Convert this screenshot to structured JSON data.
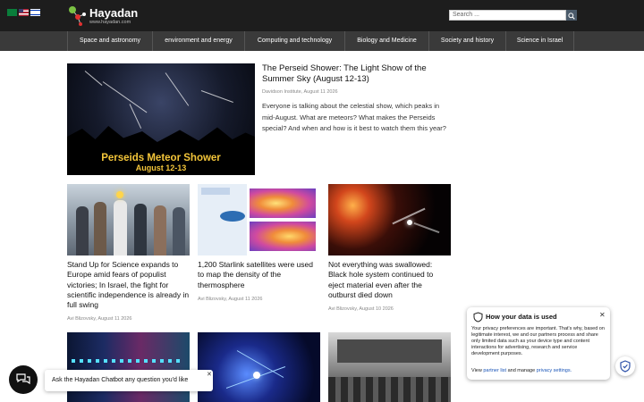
{
  "header": {
    "logo_text": "Hayadan",
    "logo_sub": "www.hayadan.com",
    "search_placeholder": "Search ..."
  },
  "nav": [
    {
      "label": "Space and astronomy"
    },
    {
      "label": "environment and energy"
    },
    {
      "label": "Computing and technology"
    },
    {
      "label": "Biology and Medicine"
    },
    {
      "label": "Society and history"
    },
    {
      "label": "Science in Israel"
    }
  ],
  "hero": {
    "image_caption_1": "Perseids Meteor Shower",
    "image_caption_2": "August 12-13",
    "title": "The Perseid Shower: The Light Show of the Summer Sky (August 12-13)",
    "meta": "Davidson Institute, August 11 2026",
    "description": "Everyone is talking about the celestial show, which peaks in mid-August. What are meteors? What makes the Perseids special? And when and how is it best to watch them this year?"
  },
  "cards": [
    {
      "title": "Stand Up for Science expands to Europe amid fears of populist victories; In Israel, the fight for scientific independence is already in full swing",
      "meta": "Avi Blizovsky, August 11 2026"
    },
    {
      "title": "1,200 Starlink satellites were used to map the density of the thermosphere",
      "meta": "Avi Blizovsky, August 11 2026"
    },
    {
      "title": "Not everything was swallowed: Black hole system continued to eject material even after the outburst died down",
      "meta": "Avi Blizovsky, August 10 2026"
    }
  ],
  "privacy": {
    "title": "How your data is used",
    "body": "Your privacy preferences are important. That's why, based on legitimate interest, we and our partners process and share only limited data such as your device type and content interactions for advertising, research and service development purposes.",
    "link_prefix": "View",
    "link_partner": "partner list",
    "link_mid": "and manage",
    "link_settings": "privacy settings."
  },
  "chat": {
    "tooltip": "Ask the Hayadan Chatbot any question you'd like"
  }
}
